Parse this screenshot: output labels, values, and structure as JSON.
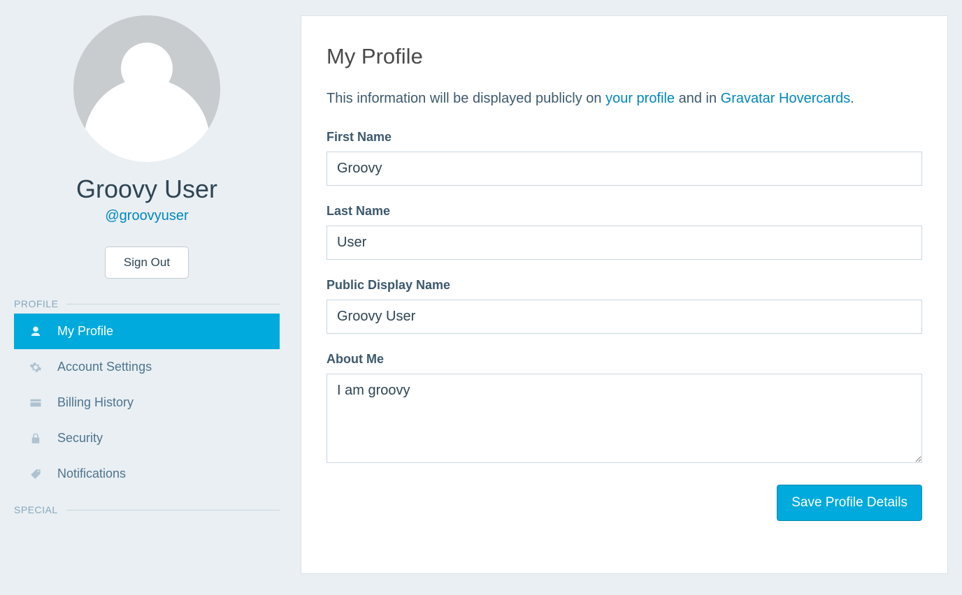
{
  "sidebar": {
    "display_name": "Groovy User",
    "handle": "@groovyuser",
    "signout_label": "Sign Out",
    "sections": {
      "profile_label": "PROFILE",
      "special_label": "SPECIAL"
    },
    "nav": [
      {
        "label": "My Profile",
        "icon": "user",
        "active": true
      },
      {
        "label": "Account Settings",
        "icon": "gear",
        "active": false
      },
      {
        "label": "Billing History",
        "icon": "card",
        "active": false
      },
      {
        "label": "Security",
        "icon": "lock",
        "active": false
      },
      {
        "label": "Notifications",
        "icon": "tag",
        "active": false
      }
    ]
  },
  "main": {
    "title": "My Profile",
    "intro_prefix": "This information will be displayed publicly on ",
    "intro_link1": "your profile",
    "intro_mid": " and in ",
    "intro_link2": "Gravatar Hovercards",
    "intro_suffix": ".",
    "fields": {
      "first_name": {
        "label": "First Name",
        "value": "Groovy"
      },
      "last_name": {
        "label": "Last Name",
        "value": "User"
      },
      "public_display_name": {
        "label": "Public Display Name",
        "value": "Groovy User"
      },
      "about_me": {
        "label": "About Me",
        "value": "I am groovy"
      }
    },
    "save_label": "Save Profile Details"
  }
}
